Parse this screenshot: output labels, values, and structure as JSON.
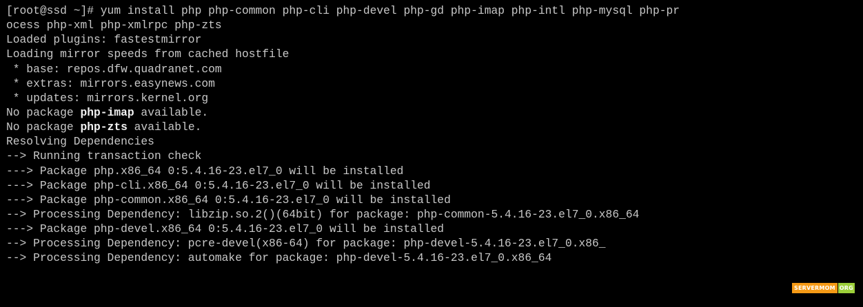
{
  "terminal": {
    "colors": {
      "background": "#000000",
      "text": "#c8c8c8",
      "bold_text": "#f2f2f2"
    },
    "lines": [
      [
        {
          "text": "[root@ssd ~]# yum install php php-common php-cli php-devel php-gd php-imap php-intl php-mysql php-pr",
          "bold": false
        }
      ],
      [
        {
          "text": "ocess php-xml php-xmlrpc php-zts",
          "bold": false
        }
      ],
      [
        {
          "text": "Loaded plugins: fastestmirror",
          "bold": false
        }
      ],
      [
        {
          "text": "Loading mirror speeds from cached hostfile",
          "bold": false
        }
      ],
      [
        {
          "text": " * base: repos.dfw.quadranet.com",
          "bold": false
        }
      ],
      [
        {
          "text": " * extras: mirrors.easynews.com",
          "bold": false
        }
      ],
      [
        {
          "text": " * updates: mirrors.kernel.org",
          "bold": false
        }
      ],
      [
        {
          "text": "No package ",
          "bold": false
        },
        {
          "text": "php-imap",
          "bold": true
        },
        {
          "text": " available.",
          "bold": false
        }
      ],
      [
        {
          "text": "No package ",
          "bold": false
        },
        {
          "text": "php-zts",
          "bold": true
        },
        {
          "text": " available.",
          "bold": false
        }
      ],
      [
        {
          "text": "Resolving Dependencies",
          "bold": false
        }
      ],
      [
        {
          "text": "--> Running transaction check",
          "bold": false
        }
      ],
      [
        {
          "text": "---> Package php.x86_64 0:5.4.16-23.el7_0 will be installed",
          "bold": false
        }
      ],
      [
        {
          "text": "---> Package php-cli.x86_64 0:5.4.16-23.el7_0 will be installed",
          "bold": false
        }
      ],
      [
        {
          "text": "---> Package php-common.x86_64 0:5.4.16-23.el7_0 will be installed",
          "bold": false
        }
      ],
      [
        {
          "text": "--> Processing Dependency: libzip.so.2()(64bit) for package: php-common-5.4.16-23.el7_0.x86_64",
          "bold": false
        }
      ],
      [
        {
          "text": "---> Package php-devel.x86_64 0:5.4.16-23.el7_0 will be installed",
          "bold": false
        }
      ],
      [
        {
          "text": "--> Processing Dependency: pcre-devel(x86-64) for package: php-devel-5.4.16-23.el7_0.x86_",
          "bold": false
        }
      ],
      [
        {
          "text": "--> Processing Dependency: automake for package: php-devel-5.4.16-23.el7_0.x86_64",
          "bold": false
        }
      ]
    ]
  },
  "watermark": {
    "main": "SERVERMOM",
    "tld": "ORG",
    "colors": {
      "main_bg": "#f59a16",
      "tld_bg": "#9ccf3a"
    }
  }
}
